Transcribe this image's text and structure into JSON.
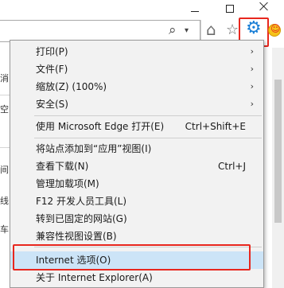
{
  "window": {
    "minimize_icon": "minimize-icon",
    "maximize_icon": "maximize-icon",
    "close_icon": "close-icon"
  },
  "toolbar": {
    "search_glyph": "⌕",
    "dropdown_glyph": "▾",
    "home_glyph": "⌂",
    "favorites_glyph": "☆",
    "tools_glyph": "⚙",
    "feedback_glyph": "☺"
  },
  "page_fragments": [
    "消",
    "空",
    "间",
    "线",
    "车"
  ],
  "menu": {
    "items": [
      {
        "label": "打印(P)",
        "submenu": true
      },
      {
        "label": "文件(F)",
        "submenu": true
      },
      {
        "label": "缩放(Z) (100%)",
        "submenu": true
      },
      {
        "label": "安全(S)",
        "submenu": true
      },
      {
        "label": "使用 Microsoft Edge 打开(E)",
        "shortcut": "Ctrl+Shift+E"
      },
      {
        "label": "将站点添加到“应用”视图(I)"
      },
      {
        "label": "查看下载(N)",
        "shortcut": "Ctrl+J"
      },
      {
        "label": "管理加载项(M)"
      },
      {
        "label": "F12 开发人员工具(L)"
      },
      {
        "label": "转到已固定的网站(G)"
      },
      {
        "label": "兼容性视图设置(B)"
      },
      {
        "label": "Internet 选项(O)",
        "highlighted": true
      },
      {
        "label": "关于 Internet Explorer(A)"
      }
    ],
    "arrow_glyph": "›"
  },
  "accent": {
    "highlight": "#e8271e",
    "gear": "#1a7fd6",
    "selection": "#cce4f7"
  }
}
